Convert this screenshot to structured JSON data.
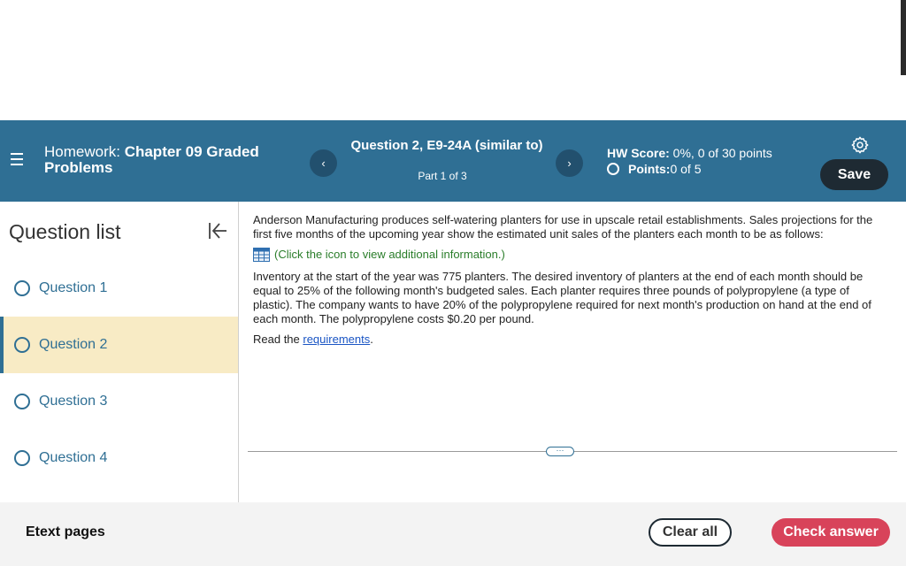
{
  "header": {
    "homework_prefix": "Homework: ",
    "homework_title": "Chapter 09 Graded Problems",
    "question_title": "Question 2, E9-24A (similar to)",
    "question_part": "Part 1 of 3",
    "prev_label": "‹",
    "next_label": "›",
    "hw_score_label": "HW Score:",
    "hw_score_value": " 0%, 0 of 30 points",
    "points_label": "Points:",
    "points_value": " 0 of 5",
    "save_label": "Save",
    "icons": {
      "menu": "hamburger-menu-icon",
      "settings": "gear-icon"
    },
    "colors": {
      "bar": "#2f6f94",
      "save": "#1e2a33"
    }
  },
  "sidebar": {
    "title": "Question list",
    "collapse_icon": "collapse-left-icon",
    "items": [
      {
        "label": "Question 1"
      },
      {
        "label": "Question 2",
        "active": true
      },
      {
        "label": "Question 3"
      },
      {
        "label": "Question 4"
      }
    ],
    "active_color": "#f8ebc5"
  },
  "content": {
    "intro": "Anderson Manufacturing produces self-watering planters for use in upscale retail establishments. Sales projections for the first five months of the upcoming year show the estimated unit sales of the planters each month to be as follows:",
    "info_link": "(Click the icon to view additional information.)",
    "body": "Inventory at the start of the year was 775 planters. The desired inventory of planters at the end of each month should be equal to 25% of the following month's budgeted sales. Each planter requires three pounds of polypropylene (a type of plastic). The company wants to have 20% of the polypropylene required for next month's production on hand at the end of each month. The polypropylene costs $0.20 per pound.",
    "read_prefix": "Read the ",
    "read_link": "requirements",
    "read_suffix": ".",
    "more_label": "···"
  },
  "footer": {
    "etext_label": "Etext pages",
    "clear_label": "Clear all",
    "check_label": "Check answer",
    "check_color": "#d8435a"
  }
}
